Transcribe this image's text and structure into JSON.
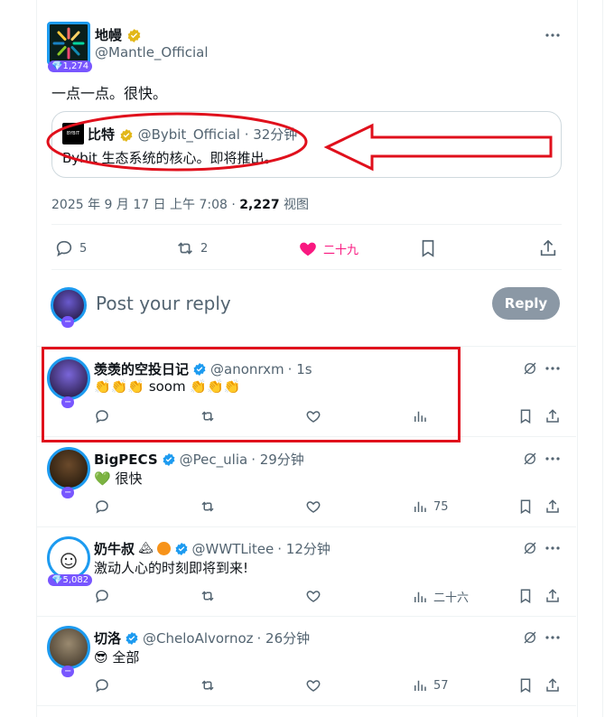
{
  "main_post": {
    "author_name": "地幔",
    "author_handle": "@Mantle_Official",
    "avatar_badge": "1,274",
    "text": "一点一点。很快。",
    "quote": {
      "logo_text": "BYBIT",
      "author_name": "比特",
      "author_handle": "@Bybit_Official",
      "time": "· 32分钟",
      "text": "Bybit 生态系统的核心。即将推出。"
    },
    "date": "2025 年 9 月 17 日 上午 7:08 ·",
    "views_count": "2,227",
    "views_label": "视图",
    "replies": "5",
    "reposts": "2",
    "likes": "二十九"
  },
  "reply_box": {
    "placeholder": "Post your reply",
    "button_label": "Reply"
  },
  "replies": [
    {
      "name": "羡羡的空投日记",
      "handle": "@anonrxm",
      "time": "· 1s",
      "text": "soom",
      "emoji": "👏👏👏",
      "badge": "",
      "views": ""
    },
    {
      "name": "BigPECS",
      "handle": "@Pec_ulia",
      "time": "· 29分钟",
      "text": "很快",
      "emoji": "💚",
      "badge": "",
      "views": "75"
    },
    {
      "name": "奶牛叔",
      "handle": "@WWTLitee",
      "time": "· 12分钟",
      "text": "激动人心的时刻即将到来!",
      "emoji": "",
      "badge": "5,082",
      "views": "二十六"
    },
    {
      "name": "切洛",
      "handle": "@CheloAlvornoz",
      "time": "· 26分钟",
      "text": "全部",
      "emoji": "😎",
      "badge": "",
      "views": "57"
    }
  ],
  "colors": {
    "accent": "#1d9bf0",
    "like": "#f91880",
    "annotation": "#e0101c",
    "badge": "#7856ff",
    "verified_gold": "#e2b719"
  }
}
